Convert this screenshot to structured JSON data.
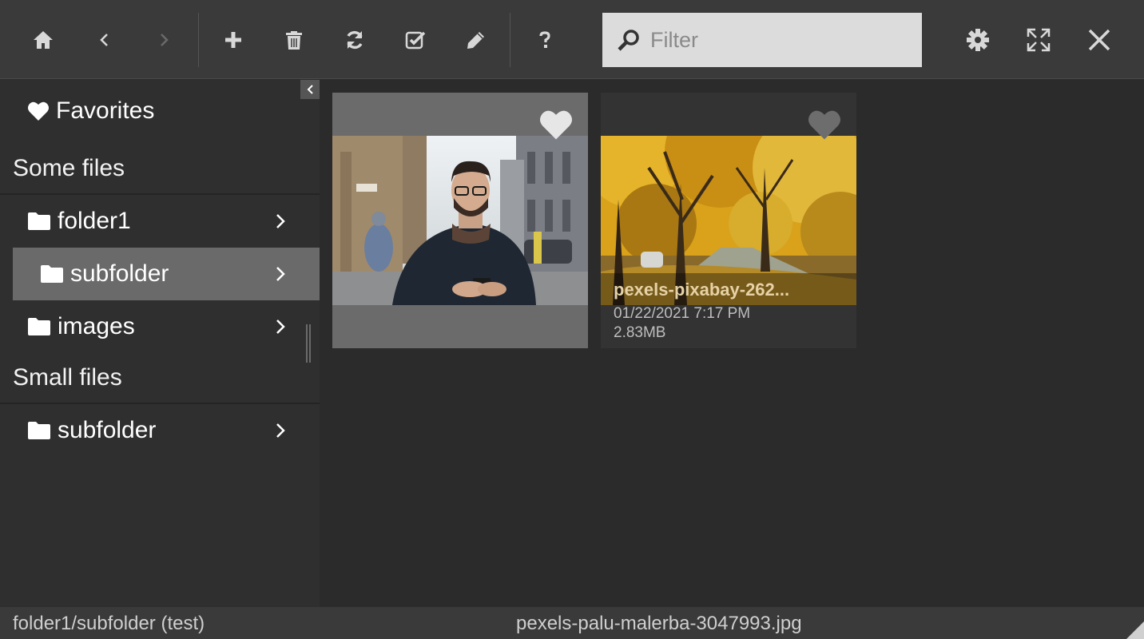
{
  "toolbar": {
    "buttons": [
      {
        "name": "home-button",
        "icon": "home-icon"
      },
      {
        "name": "back-button",
        "icon": "chevron-left-icon"
      },
      {
        "name": "forward-button",
        "icon": "chevron-right-icon"
      },
      {
        "name": "add-button",
        "icon": "plus-icon"
      },
      {
        "name": "delete-button",
        "icon": "trash-icon"
      },
      {
        "name": "refresh-button",
        "icon": "refresh-icon"
      },
      {
        "name": "select-button",
        "icon": "checkbox-icon"
      },
      {
        "name": "rename-button",
        "icon": "pencil-icon"
      },
      {
        "name": "help-button",
        "icon": "question-icon"
      },
      {
        "name": "settings-button",
        "icon": "gear-icon"
      },
      {
        "name": "fullscreen-button",
        "icon": "expand-icon"
      },
      {
        "name": "close-button",
        "icon": "close-icon"
      }
    ],
    "filter": {
      "placeholder": "Filter",
      "value": ""
    }
  },
  "sidebar": {
    "favorites_label": "Favorites",
    "sections": [
      {
        "title": "Some files",
        "items": [
          {
            "label": "folder1",
            "level": 0,
            "selected": false
          },
          {
            "label": "subfolder",
            "level": 1,
            "selected": true
          },
          {
            "label": "images",
            "level": 0,
            "selected": false
          }
        ]
      },
      {
        "title": "Small files",
        "items": [
          {
            "label": "subfolder",
            "level": 0,
            "selected": false
          }
        ]
      }
    ]
  },
  "files": [
    {
      "thumbnail": "photo-man-with-phone",
      "favorite": true,
      "selected": true
    },
    {
      "name": "pexels-pixabay-262...",
      "date": "01/22/2021 7:17 PM",
      "size": "2.83MB",
      "thumbnail": "photo-autumn-trees",
      "favorite": false,
      "selected": false
    }
  ],
  "status": {
    "path": "folder1/subfolder (test)",
    "selected_file": "pexels-palu-malerba-3047993.jpg"
  },
  "colors": {
    "toolbar_bg": "#3a3a3a",
    "sidebar_bg": "#2f2f2f",
    "main_bg": "#2b2b2b",
    "selection_bg": "#6a6a6a",
    "filter_bg": "#dcdcdc",
    "file_name_color": "#e6d2a6"
  }
}
